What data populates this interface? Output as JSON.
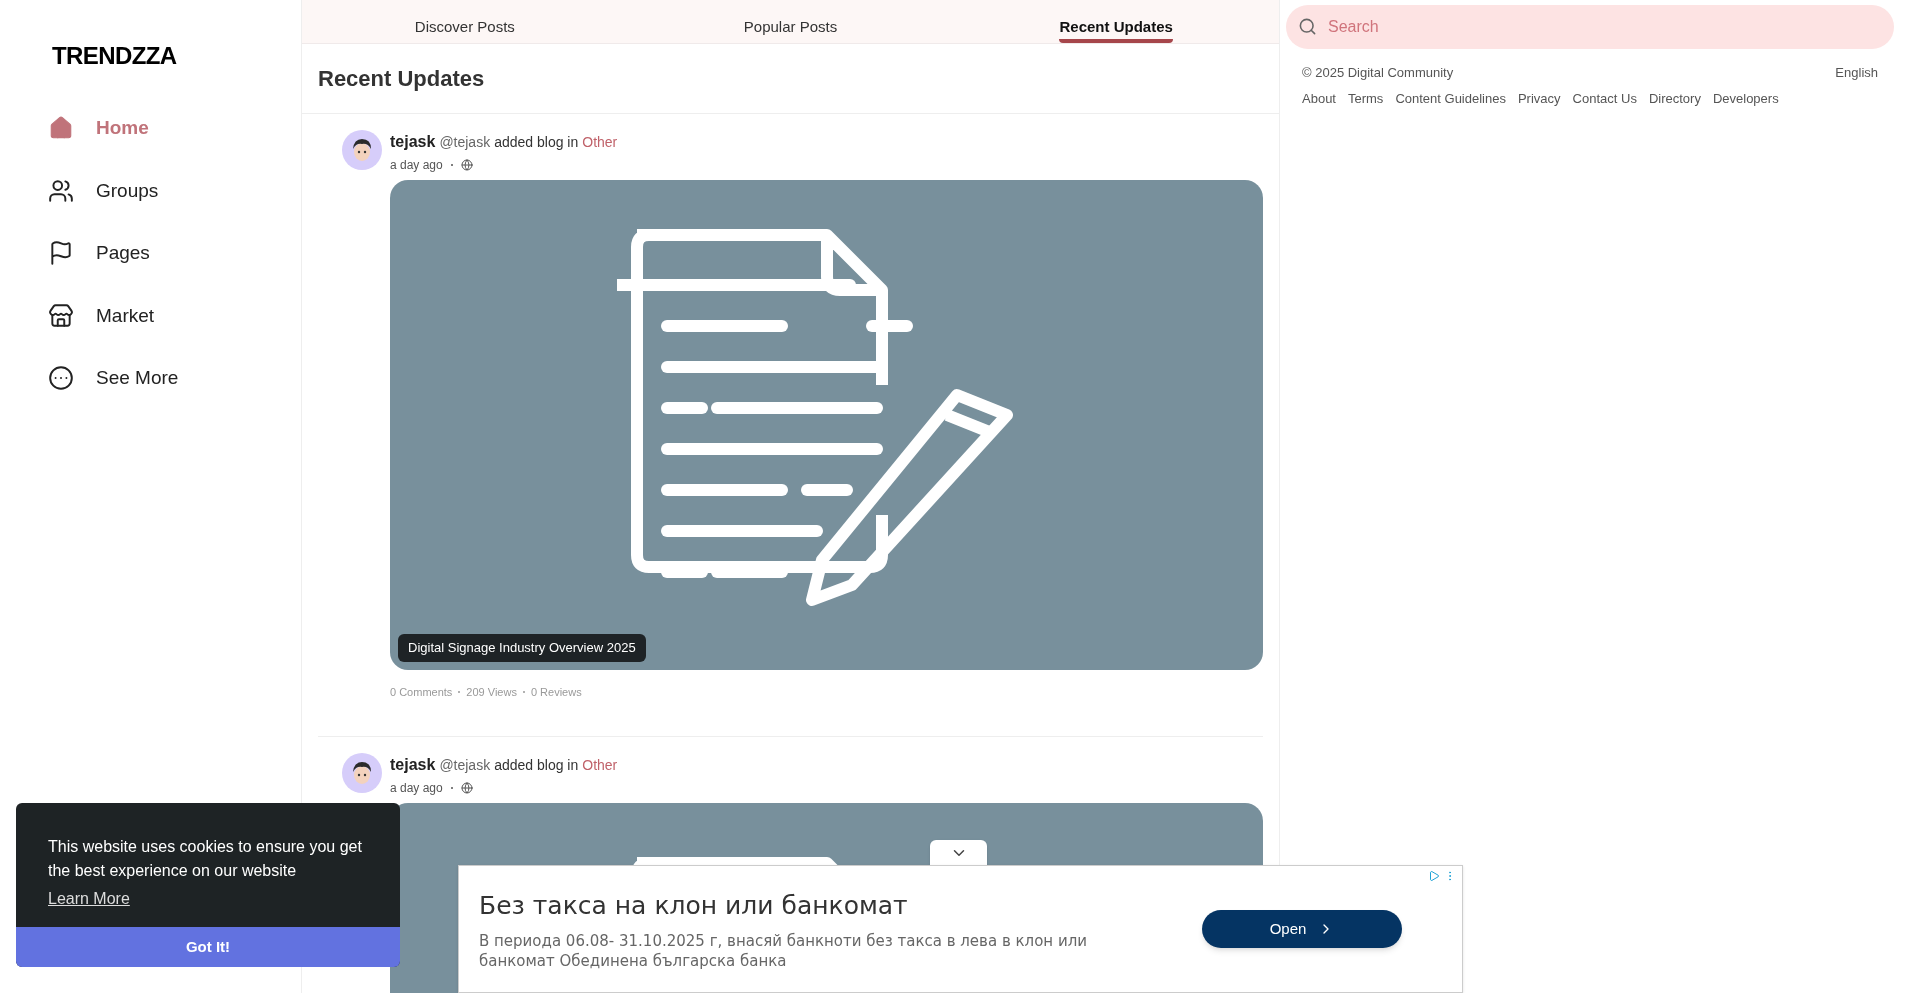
{
  "logo": "TRENDZZA",
  "sidebar": {
    "items": [
      {
        "label": "Home",
        "selected": true,
        "kind": "home"
      },
      {
        "label": "Groups",
        "selected": false,
        "kind": "groups"
      },
      {
        "label": "Pages",
        "selected": false,
        "kind": "pages"
      },
      {
        "label": "Market",
        "selected": false,
        "kind": "market"
      },
      {
        "label": "See More",
        "selected": false,
        "kind": "more"
      }
    ]
  },
  "tabs": [
    {
      "label": "Discover Posts",
      "selected": false
    },
    {
      "label": "Popular Posts",
      "selected": false
    },
    {
      "label": "Recent Updates",
      "selected": true
    }
  ],
  "feed_title": "Recent Updates",
  "posts": [
    {
      "author": "tejask",
      "handle": "@tejask",
      "action": "added blog in",
      "category": "Other",
      "time": "a day ago",
      "caption": "Digital Signage Industry Overview 2025",
      "stats": [
        "0 Comments",
        "209 Views",
        "0 Reviews"
      ]
    },
    {
      "author": "tejask",
      "handle": "@tejask",
      "action": "added blog in",
      "category": "Other",
      "time": "a day ago"
    }
  ],
  "search": {
    "placeholder": "Search"
  },
  "footer": {
    "copyright": "© 2025 Digital Community",
    "language": "English",
    "links": [
      "About",
      "Terms",
      "Content Guidelines",
      "Privacy",
      "Contact Us",
      "Directory",
      "Developers"
    ]
  },
  "cookie_banner": {
    "message": "This website uses cookies to ensure you get the best experience on our website",
    "link": "Learn More",
    "button": "Got It!"
  },
  "ad": {
    "title": "Без такса на клон или банкомат",
    "body": "В периода 06.08- 31.10.2025 г, внасяй банкноти без такса в лева в клон или банкомат Обединена българска банка",
    "button": "Open"
  }
}
